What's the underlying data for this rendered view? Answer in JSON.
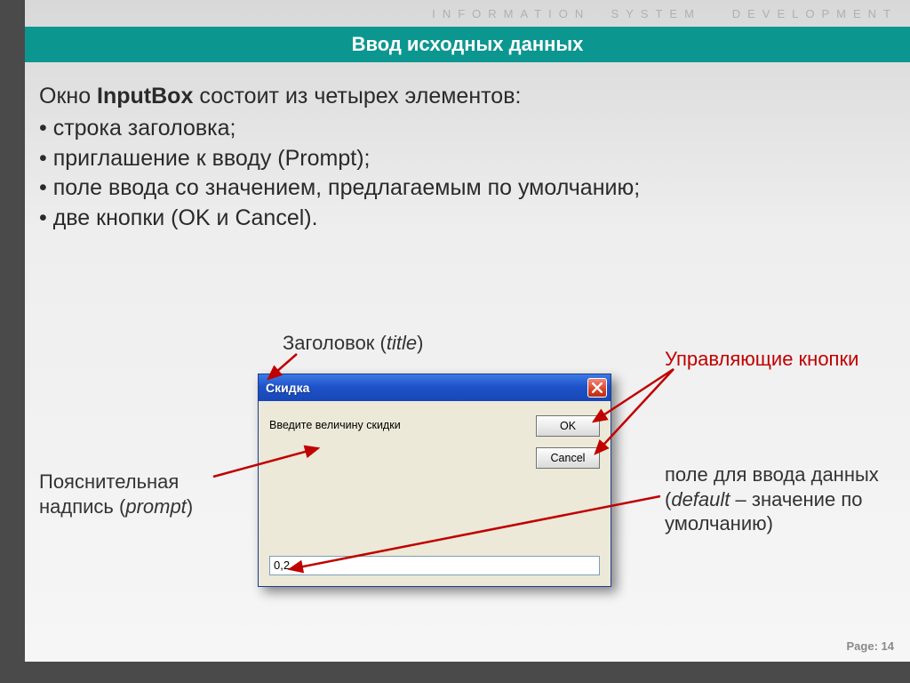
{
  "header": {
    "subheader": "INFORMATION  SYSTEM   DEVELOPMENT",
    "title": "Ввод исходных данных"
  },
  "body": {
    "intro_pre": "Окно ",
    "intro_bold": "InputBox",
    "intro_post": " состоит из четырех элементов:",
    "bullets": [
      "• строка заголовка;",
      "• приглашение к вводу (Prompt);",
      "• поле ввода со значением, предлагаемым по умолчанию;",
      "• две кнопки (OK и Cancel)."
    ]
  },
  "annotations": {
    "title_label_pre": "Заголовок (",
    "title_label_it": "title",
    "title_label_post": ")",
    "prompt_label_pre": "Пояснительная надпись (",
    "prompt_label_it": "prompt",
    "prompt_label_post": ")",
    "buttons_label": "Управляющие кнопки",
    "default_label_pre": "поле для ввода данных (",
    "default_label_it": "default",
    "default_label_post": " – значение по умолчанию)"
  },
  "dialog": {
    "title": "Скидка",
    "prompt": "Введите величину скидки",
    "ok": "OK",
    "cancel": "Cancel",
    "value": "0,2"
  },
  "footer": {
    "page": "Page: 14"
  }
}
